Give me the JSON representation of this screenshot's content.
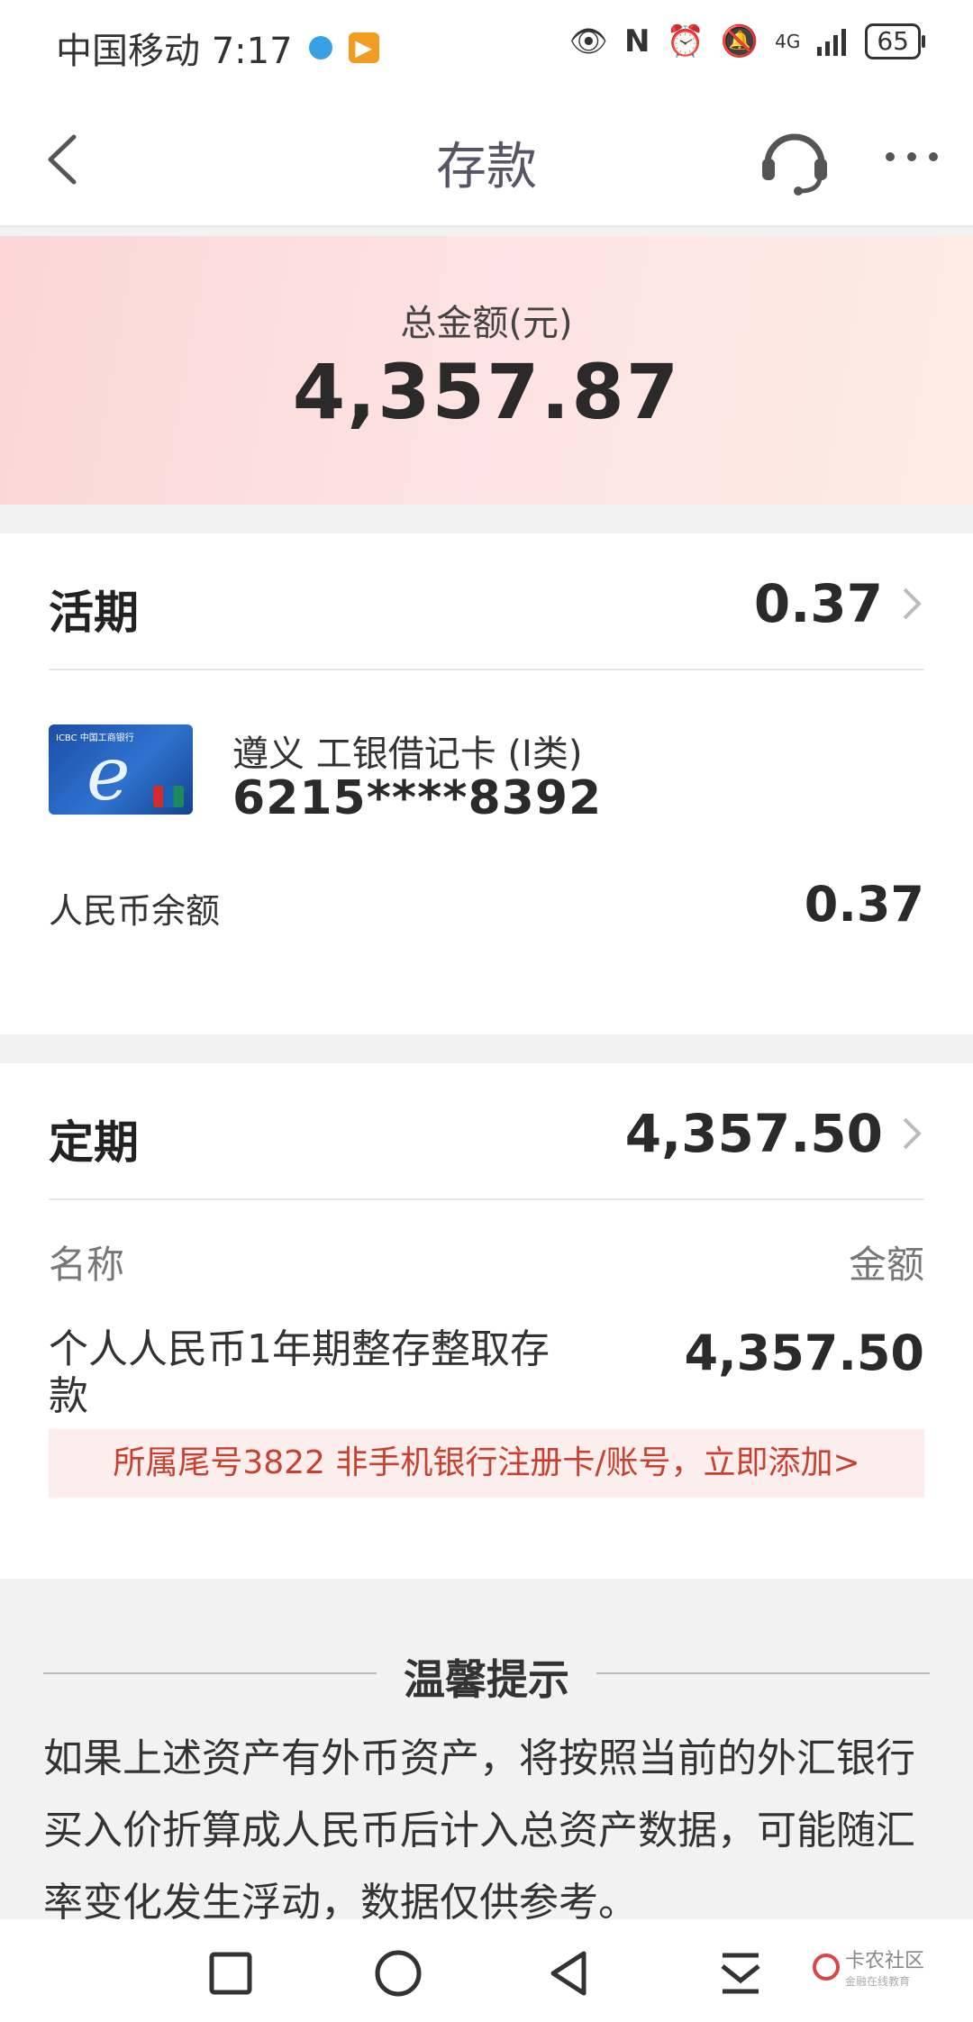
{
  "status_bar": {
    "carrier_time": "中国移动 7:17",
    "network": "4G",
    "battery": "65",
    "icons": [
      "dot-icon",
      "app-badge-icon",
      "eye-icon",
      "nfc-icon",
      "alarm-icon",
      "mute-icon",
      "signal-icon",
      "battery-icon"
    ]
  },
  "nav": {
    "title": "存款",
    "icons": [
      "back-arrow-icon",
      "customer-service-icon",
      "more-icon"
    ]
  },
  "total": {
    "label": "总金额(元)",
    "amount": "4,357.87"
  },
  "current_deposit": {
    "title": "活期",
    "amount": "0.37",
    "account": {
      "name": "遵义 工银借记卡 (I类)",
      "number": "6215****8392",
      "card_logo_text": "ICBC 中国工商银行"
    },
    "rmb_label": "人民币余额",
    "rmb_value": "0.37"
  },
  "fixed_deposit": {
    "title": "定期",
    "amount": "4,357.50",
    "col_name": "名称",
    "col_amount": "金额",
    "product_name": "个人人民币1年期整存整取存款",
    "product_amount": "4,357.50",
    "notice": "所属尾号3822 非手机银行注册卡/账号，立即添加>"
  },
  "tips": {
    "title": "温馨提示",
    "text": "如果上述资产有外币资产，将按照当前的外汇银行买入价折算成人民币后计入总资产数据，可能随汇率变化发生浮动，数据仅供参考。"
  },
  "bottom_nav": {
    "icons": [
      "square-icon",
      "circle-icon",
      "back-triangle-icon",
      "download-icon"
    ],
    "watermark_main": "卡农社区",
    "watermark_sub": "金融在线教育"
  },
  "colors": {
    "notice_text": "#c8412f",
    "notice_bg": "#fdeeee",
    "total_bg": "#fcd6d6"
  }
}
